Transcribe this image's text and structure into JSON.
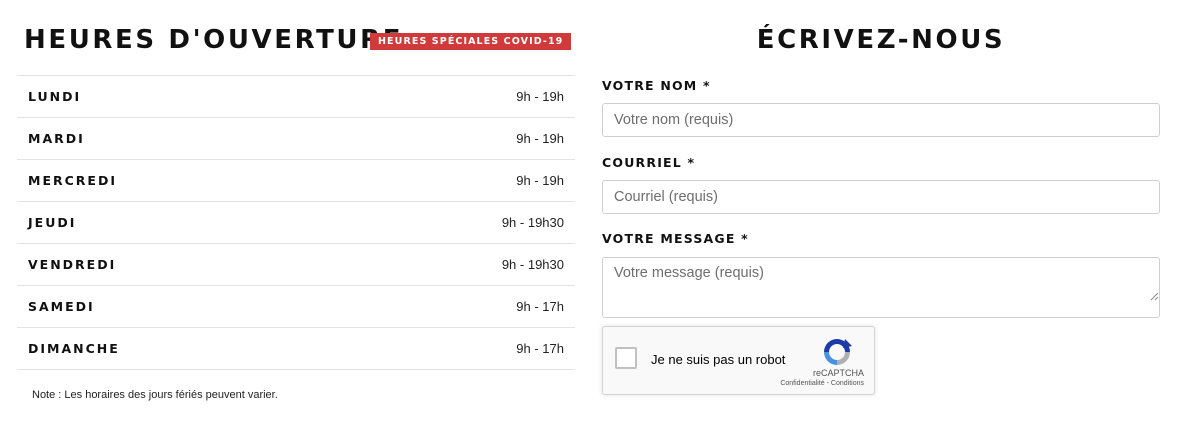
{
  "hours": {
    "title": "HEURES D'OUVERTURE",
    "badge": "HEURES SPÉCIALES COVID-19",
    "badge_color": "#d13a3a",
    "rows": [
      {
        "day": "LUNDI",
        "time": "9h - 19h"
      },
      {
        "day": "MARDI",
        "time": "9h - 19h"
      },
      {
        "day": "MERCREDI",
        "time": "9h - 19h"
      },
      {
        "day": "JEUDI",
        "time": "9h - 19h30"
      },
      {
        "day": "VENDREDI",
        "time": "9h - 19h30"
      },
      {
        "day": "SAMEDI",
        "time": "9h - 17h"
      },
      {
        "day": "DIMANCHE",
        "time": "9h - 17h"
      }
    ],
    "note": "Note : Les horaires des jours fériés peuvent varier."
  },
  "form": {
    "title": "ÉCRIVEZ-NOUS",
    "name_label": "VOTRE NOM *",
    "name_placeholder": "Votre nom (requis)",
    "email_label": "COURRIEL *",
    "email_placeholder": "Courriel (requis)",
    "message_label": "VOTRE MESSAGE *",
    "message_placeholder": "Votre message (requis)"
  },
  "captcha": {
    "text": "Je ne suis pas un robot",
    "brand": "reCAPTCHA",
    "links": "Confidentialité - Conditions",
    "icon": "recaptcha-icon"
  }
}
